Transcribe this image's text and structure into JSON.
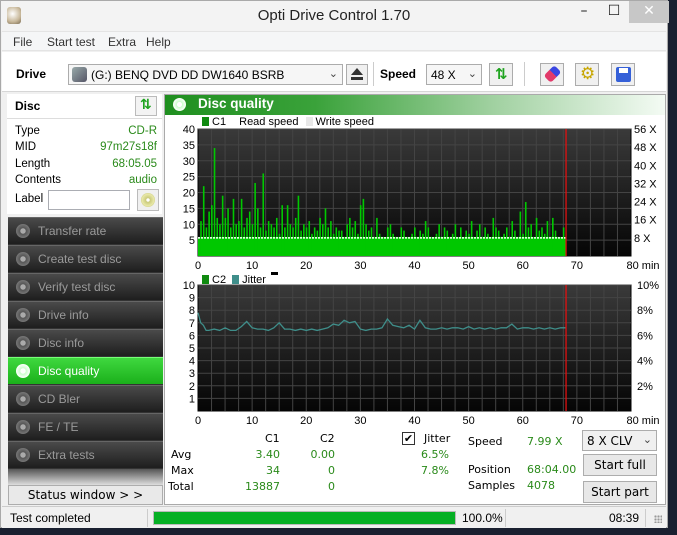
{
  "window": {
    "title": "Opti Drive Control 1.70",
    "controls": {
      "minimize": "–",
      "maximize": "☐",
      "close": "✕"
    }
  },
  "menu": [
    "File",
    "Start test",
    "Extra",
    "Help"
  ],
  "toolbar": {
    "drive_label": "Drive",
    "drive_value": "(G:)  BENQ DVD DD DW1640 BSRB",
    "speed_label": "Speed",
    "speed_value": "48 X",
    "chevron": "⌄",
    "icons": [
      "eject-icon",
      "refresh-icon",
      "erase-icon",
      "settings-icon",
      "save-icon"
    ]
  },
  "disc": {
    "title": "Disc",
    "rows": [
      {
        "key": "Type",
        "value": "CD-R"
      },
      {
        "key": "MID",
        "value": "97m27s18f"
      },
      {
        "key": "Length",
        "value": "68:05.05"
      },
      {
        "key": "Contents",
        "value": "audio"
      }
    ],
    "label_key": "Label",
    "label_value": ""
  },
  "nav": [
    {
      "label": "Transfer rate",
      "active": false
    },
    {
      "label": "Create test disc",
      "active": false
    },
    {
      "label": "Verify test disc",
      "active": false
    },
    {
      "label": "Drive info",
      "active": false
    },
    {
      "label": "Disc info",
      "active": false
    },
    {
      "label": "Disc quality",
      "active": true
    },
    {
      "label": "CD Bler",
      "active": false
    },
    {
      "label": "FE / TE",
      "active": false
    },
    {
      "label": "Extra tests",
      "active": false
    }
  ],
  "status_window_button": "Status window > >",
  "main": {
    "title": "Disc quality",
    "legend_top": [
      {
        "label": "C1",
        "color": "#108a10"
      },
      {
        "label": "Read speed",
        "color": null
      },
      {
        "label": "Write speed",
        "color": "#e8e8e8"
      }
    ],
    "legend_bottom": [
      {
        "label": "C2",
        "color": "#108a10"
      },
      {
        "label": "Jitter",
        "color": "#3f8e8a"
      }
    ]
  },
  "chart_data": [
    {
      "type": "bar",
      "title": "C1 / Read speed",
      "xlabel": "min",
      "x_range": [
        0,
        80
      ],
      "x_ticks": [
        0,
        10,
        20,
        30,
        40,
        50,
        60,
        70,
        80
      ],
      "x_tick_labels": [
        "0",
        "10",
        "20",
        "30",
        "40",
        "50",
        "60",
        "70",
        "80 min"
      ],
      "ylim_left": [
        0,
        40
      ],
      "y_ticks_left": [
        5,
        10,
        15,
        20,
        25,
        30,
        35,
        40
      ],
      "ylim_right": [
        0,
        56
      ],
      "y_ticks_right_labels": [
        "8 X",
        "16 X",
        "24 X",
        "32 X",
        "40 X",
        "48 X",
        "56 X"
      ],
      "y_ticks_right": [
        8,
        16,
        24,
        32,
        40,
        48,
        56
      ],
      "end_marker_min": 68,
      "series": [
        {
          "name": "C1",
          "color": "#00c800",
          "x": [
            0.5,
            1,
            1.5,
            2,
            2.5,
            3,
            3.5,
            4,
            4.5,
            5,
            5.5,
            6,
            6.5,
            7,
            7.5,
            8,
            8.5,
            9,
            9.5,
            10,
            10.5,
            11,
            11.5,
            12,
            12.5,
            13,
            13.5,
            14,
            14.5,
            15,
            15.5,
            16,
            16.5,
            17,
            17.5,
            18,
            18.5,
            19,
            19.5,
            20,
            20.5,
            21,
            21.5,
            22,
            22.5,
            23,
            23.5,
            24,
            24.5,
            25,
            25.5,
            26,
            26.5,
            27,
            27.5,
            28,
            28.5,
            29,
            29.5,
            30,
            30.5,
            31,
            31.5,
            32,
            32.5,
            33,
            33.5,
            34,
            34.5,
            35,
            35.5,
            36,
            36.5,
            37,
            37.5,
            38,
            38.5,
            39,
            39.5,
            40,
            40.5,
            41,
            41.5,
            42,
            42.5,
            43,
            43.5,
            44,
            44.5,
            45,
            45.5,
            46,
            46.5,
            47,
            47.5,
            48,
            48.5,
            49,
            49.5,
            50,
            50.5,
            51,
            51.5,
            52,
            52.5,
            53,
            53.5,
            54,
            54.5,
            55,
            55.5,
            56,
            56.5,
            57,
            57.5,
            58,
            58.5,
            59,
            59.5,
            60,
            60.5,
            61,
            61.5,
            62,
            62.5,
            63,
            63.5,
            64,
            64.5,
            65,
            65.5,
            66,
            66.5,
            67,
            67.5
          ],
          "values": [
            11,
            22,
            9,
            14,
            16,
            34,
            12,
            10,
            19,
            12,
            15,
            9,
            18,
            10,
            11,
            18,
            9,
            12,
            14,
            10,
            23,
            15,
            9,
            26,
            8,
            11,
            10,
            9,
            12,
            7,
            16,
            9,
            16,
            10,
            9,
            12,
            19,
            8,
            10,
            9,
            11,
            7,
            9,
            8,
            12,
            10,
            15,
            9,
            11,
            7,
            9,
            8,
            8,
            6,
            10,
            12,
            9,
            11,
            7,
            16,
            18,
            10,
            8,
            9,
            6,
            12,
            7,
            6,
            5,
            9,
            10,
            7,
            6,
            5,
            9,
            8,
            6,
            5,
            7,
            9,
            6,
            8,
            7,
            11,
            9,
            6,
            5,
            7,
            10,
            6,
            9,
            8,
            6,
            7,
            10,
            5,
            9,
            6,
            8,
            7,
            11,
            6,
            8,
            10,
            6,
            9,
            7,
            5,
            12,
            9,
            8,
            6,
            7,
            9,
            6,
            11,
            8,
            6,
            14,
            7,
            17,
            9,
            10,
            6,
            12,
            8,
            9,
            7,
            11,
            6,
            12,
            8,
            6,
            5,
            9,
            10,
            7,
            8,
            6,
            5
          ]
        },
        {
          "name": "Read speed",
          "color": "#ffffff",
          "x": [
            0,
            67.9
          ],
          "values_x": [
            8,
            8
          ]
        }
      ]
    },
    {
      "type": "line",
      "title": "C2 / Jitter",
      "xlabel": "min",
      "x_range": [
        0,
        80
      ],
      "x_ticks": [
        0,
        10,
        20,
        30,
        40,
        50,
        60,
        70,
        80
      ],
      "x_tick_labels": [
        "0",
        "10",
        "20",
        "30",
        "40",
        "50",
        "60",
        "70",
        "80 min"
      ],
      "ylim_left": [
        0,
        10
      ],
      "y_ticks_left": [
        1,
        2,
        3,
        4,
        5,
        6,
        7,
        8,
        9,
        10
      ],
      "ylim_right_percent": [
        0,
        10
      ],
      "y_ticks_right_labels": [
        "2%",
        "4%",
        "6%",
        "8%",
        "10%"
      ],
      "y_ticks_right": [
        2,
        4,
        6,
        8,
        10
      ],
      "end_marker_min": 68,
      "series": [
        {
          "name": "C2",
          "color": "#108a10",
          "x": [
            0,
            68
          ],
          "values": [
            0,
            0
          ]
        },
        {
          "name": "Jitter",
          "color": "#3f8e8a",
          "x": [
            0,
            0.5,
            1,
            1.5,
            2,
            3,
            4,
            5,
            6,
            7,
            8,
            9,
            10,
            11,
            12,
            13,
            14,
            15,
            16,
            17,
            18,
            19,
            20,
            21,
            22,
            23,
            24,
            25,
            26,
            27,
            28,
            29,
            30,
            31,
            32,
            33,
            34,
            35,
            36,
            37,
            38,
            39,
            40,
            41,
            42,
            43,
            44,
            45,
            46,
            47,
            48,
            49,
            50,
            51,
            52,
            53,
            54,
            55,
            56,
            57,
            58,
            59,
            60,
            61,
            62,
            63,
            64,
            65,
            66,
            67,
            68
          ],
          "values": [
            7.8,
            7.0,
            6.8,
            6.4,
            6.4,
            6.5,
            6.4,
            6.6,
            6.4,
            6.4,
            6.7,
            7.1,
            6.6,
            6.5,
            6.5,
            6.4,
            6.6,
            7.0,
            6.5,
            6.5,
            6.4,
            6.5,
            6.4,
            6.5,
            6.4,
            6.5,
            6.6,
            6.9,
            6.8,
            7.2,
            7.0,
            7.1,
            6.5,
            6.4,
            6.5,
            6.5,
            6.6,
            7.3,
            6.8,
            6.7,
            6.6,
            6.8,
            6.5,
            7.2,
            6.6,
            6.5,
            6.5,
            6.6,
            6.5,
            6.6,
            6.6,
            6.5,
            6.7,
            6.5,
            6.6,
            6.5,
            6.6,
            6.5,
            6.6,
            6.6,
            6.9,
            6.5,
            6.6,
            6.6,
            6.5,
            6.6,
            6.5,
            6.6,
            6.5,
            6.6,
            6.6
          ]
        }
      ]
    }
  ],
  "stats": {
    "headers": [
      "C1",
      "C2"
    ],
    "jitter_checked": true,
    "jitter_label": "Jitter",
    "check_glyph": "✔",
    "rows": [
      {
        "label": "Avg",
        "c1": "3.40",
        "c2": "0.00",
        "jitter": "6.5%"
      },
      {
        "label": "Max",
        "c1": "34",
        "c2": "0",
        "jitter": "7.8%"
      },
      {
        "label": "Total",
        "c1": "13887",
        "c2": "0",
        "jitter": ""
      }
    ],
    "speed_label": "Speed",
    "speed_value": "7.99 X",
    "position_label": "Position",
    "position_value": "68:04.00",
    "samples_label": "Samples",
    "samples_value": "4078",
    "mode_value": "8 X CLV",
    "start_full": "Start full",
    "start_part": "Start part"
  },
  "statusbar": {
    "text": "Test completed",
    "progress_percent": 100,
    "progress_label": "100.0%",
    "elapsed": "08:39"
  }
}
